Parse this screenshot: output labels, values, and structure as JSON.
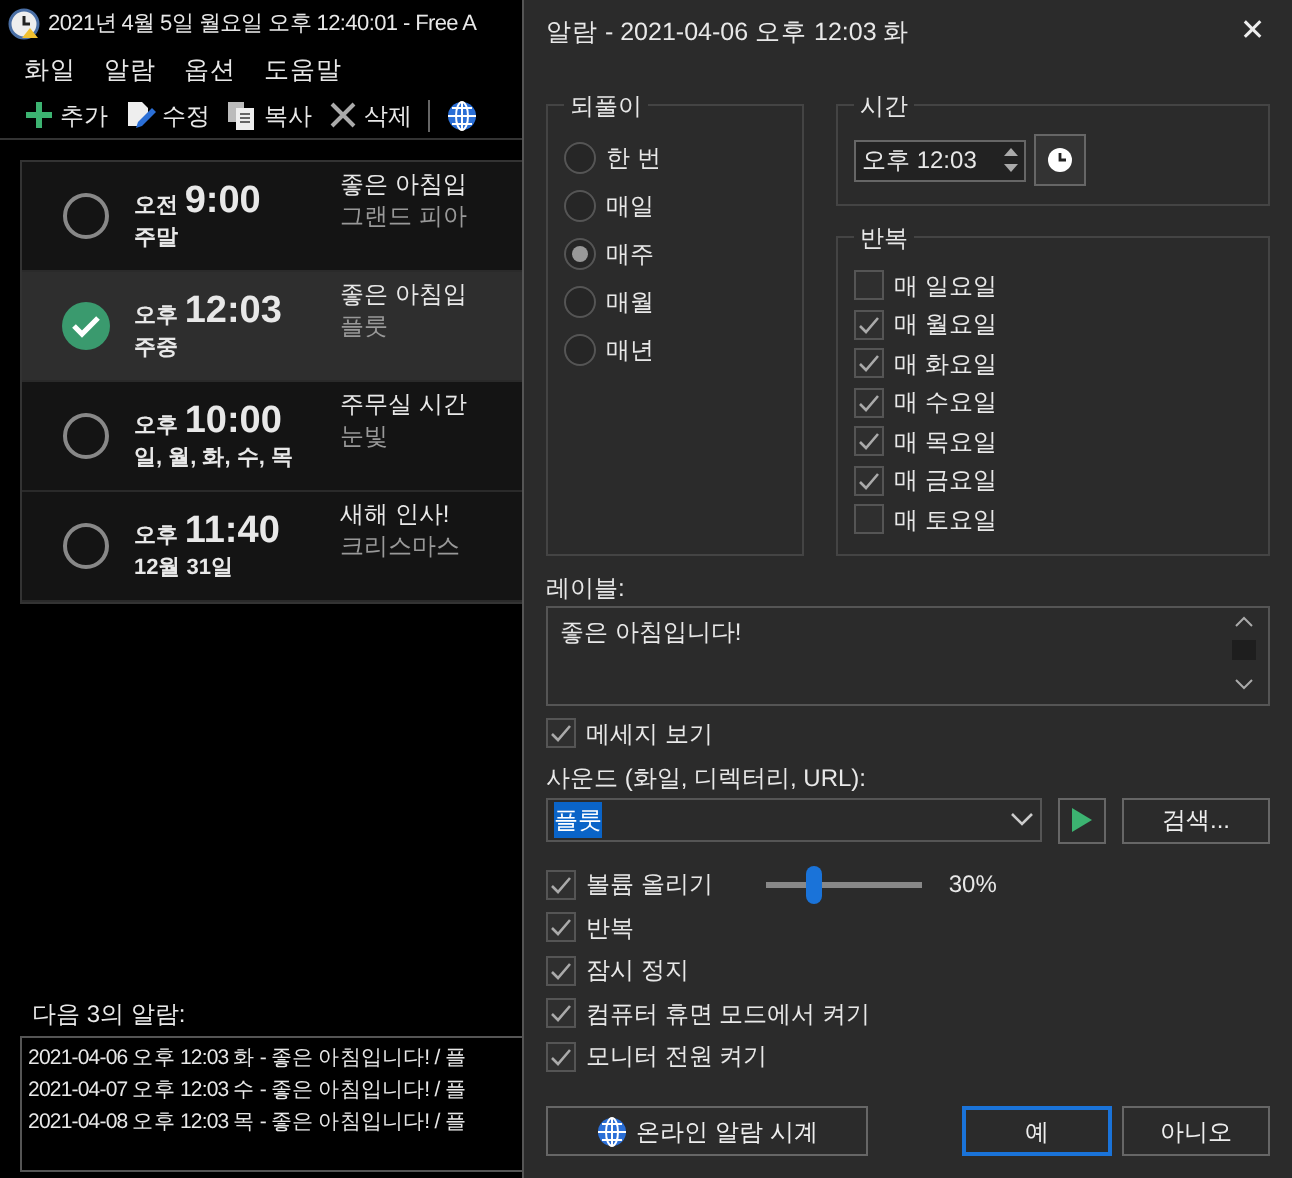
{
  "main_window": {
    "title": "2021년 4월 5일 월요일 오후 12:40:01 - Free A",
    "menu": [
      "화일",
      "알람",
      "옵션",
      "도움말"
    ],
    "toolbar": [
      {
        "kind": "add",
        "label": "추가"
      },
      {
        "kind": "edit",
        "label": "수정"
      },
      {
        "kind": "copy",
        "label": "복사"
      },
      {
        "kind": "delete",
        "label": "삭제"
      },
      {
        "kind": "globe"
      }
    ],
    "alarms": [
      {
        "period": "오전",
        "time": "9:00",
        "days": "주말",
        "label": "좋은 아침입",
        "sound": "그랜드 피아",
        "enabled": false,
        "selected": false
      },
      {
        "period": "오후",
        "time": "12:03",
        "days": "주중",
        "label": "좋은 아침입",
        "sound": "플룻",
        "enabled": true,
        "selected": true
      },
      {
        "period": "오후",
        "time": "10:00",
        "days": "일, 월, 화, 수, 목",
        "label": "주무실 시간",
        "sound": "눈빛",
        "enabled": false,
        "selected": false
      },
      {
        "period": "오후",
        "time": "11:40",
        "days": "12월 31일",
        "label": "새해 인사!",
        "sound": "크리스마스",
        "enabled": false,
        "selected": false
      }
    ],
    "upcoming_label": "다음 3의 알람:",
    "upcoming": [
      "2021-04-06 오후 12:03 화 - 좋은 아침입니다! / 플",
      "2021-04-07 오후 12:03 수 - 좋은 아침입니다! / 플",
      "2021-04-08 오후 12:03 목 - 좋은 아침입니다! / 플"
    ]
  },
  "dialog": {
    "title": "알람 - 2021-04-06 오후 12:03 화",
    "close": "✕",
    "recurrence": {
      "title": "되풀이",
      "options": [
        {
          "label": "한 번",
          "selected": false
        },
        {
          "label": "매일",
          "selected": false
        },
        {
          "label": "매주",
          "selected": true
        },
        {
          "label": "매월",
          "selected": false
        },
        {
          "label": "매년",
          "selected": false
        }
      ]
    },
    "time": {
      "title": "시간",
      "value": "오후 12:03"
    },
    "repeat": {
      "title": "반복",
      "days": [
        {
          "label": "매 일요일",
          "checked": false
        },
        {
          "label": "매 월요일",
          "checked": true
        },
        {
          "label": "매 화요일",
          "checked": true
        },
        {
          "label": "매 수요일",
          "checked": true
        },
        {
          "label": "매 목요일",
          "checked": true
        },
        {
          "label": "매 금요일",
          "checked": true
        },
        {
          "label": "매 토요일",
          "checked": false
        }
      ]
    },
    "label_caption": "레이블:",
    "label_text": "좋은 아침입니다!",
    "show_message": {
      "label": "메세지 보기",
      "checked": true
    },
    "sound_caption": "사운드 (화일, 디렉터리, URL):",
    "sound_value": "플룻",
    "browse_button": "검색...",
    "options": [
      {
        "kind": "slider",
        "label": "볼륨 올리기",
        "checked": true,
        "level": 0.3,
        "reading": "30%"
      },
      {
        "kind": "checkbox",
        "label": "반복",
        "checked": true
      },
      {
        "kind": "checkbox",
        "label": "잠시 정지",
        "checked": true
      },
      {
        "kind": "checkbox",
        "label": "컴퓨터 휴면 모드에서 켜기",
        "checked": true
      },
      {
        "kind": "checkbox",
        "label": "모니터 전원 켜기",
        "checked": true
      }
    ],
    "online_button": "온라인 알람 시계",
    "ok_button": "예",
    "cancel_button": "아니오"
  }
}
